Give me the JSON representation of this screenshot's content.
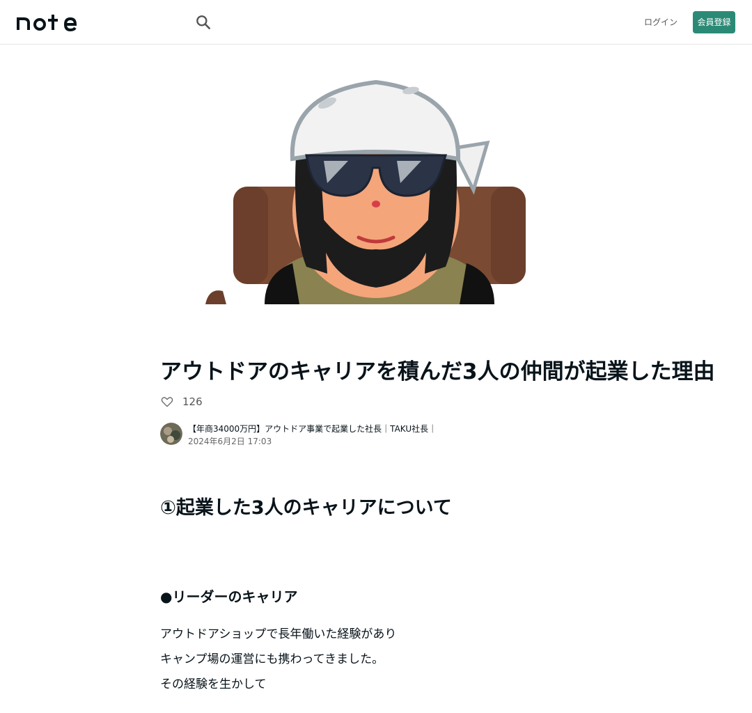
{
  "header": {
    "logo_text": "note",
    "login_label": "ログイン",
    "signup_label": "会員登録"
  },
  "article": {
    "title": "アウトドアのキャリアを積んだ3人の仲間が起業した理由",
    "likes": "126",
    "author": "【年商34000万円】アウトドア事業で起業した社長｜TAKU社長｜",
    "date": "2024年6月2日 17:03",
    "heading": "①起業した3人のキャリアについて",
    "subheading": "●リーダーのキャリア",
    "body_lines": [
      "アウトドアショップで長年働いた経験があり",
      "キャンプ場の運営にも携わってきました。",
      "その経験を生かして"
    ]
  },
  "colors": {
    "accent": "#2b8a76",
    "text": "#08131a"
  },
  "icons": {
    "search": "search-icon",
    "like": "heart-icon"
  }
}
